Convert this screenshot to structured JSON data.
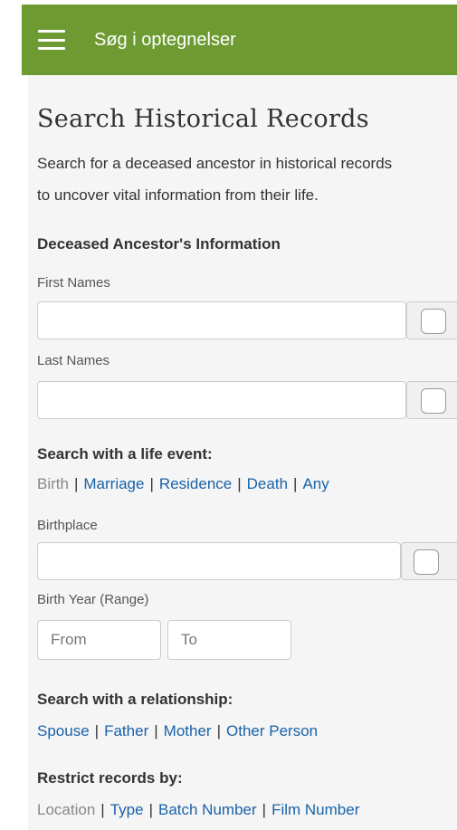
{
  "topbar": {
    "menu_icon": "hamburger-menu-icon",
    "title": "Søg i optegnelser",
    "background": "#6d9b32"
  },
  "page": {
    "title": "Search Historical Records",
    "intro_line1": "Search for a deceased ancestor in historical records",
    "intro_line2": "to uncover vital information from their life."
  },
  "ancestor": {
    "heading": "Deceased Ancestor's Information",
    "first_names_label": "First Names",
    "first_names_value": "",
    "last_names_label": "Last Names",
    "last_names_value": ""
  },
  "life_event": {
    "heading": "Search with a life event:",
    "options": [
      "Birth",
      "Marriage",
      "Residence",
      "Death",
      "Any"
    ],
    "selected": "Birth",
    "separator": "|",
    "birthplace_label": "Birthplace",
    "birthplace_value": "",
    "birth_year_label": "Birth Year (Range)",
    "from_placeholder": "From",
    "to_placeholder": "To"
  },
  "relationship": {
    "heading": "Search with a relationship:",
    "options": [
      "Spouse",
      "Father",
      "Mother",
      "Other Person"
    ]
  },
  "restrict": {
    "heading": "Restrict records by:",
    "options": [
      "Location",
      "Type",
      "Batch Number",
      "Film Number"
    ],
    "selected": "Location"
  },
  "colors": {
    "link": "#1a62a8",
    "muted": "#888888",
    "panel": "#f5f5f5"
  }
}
